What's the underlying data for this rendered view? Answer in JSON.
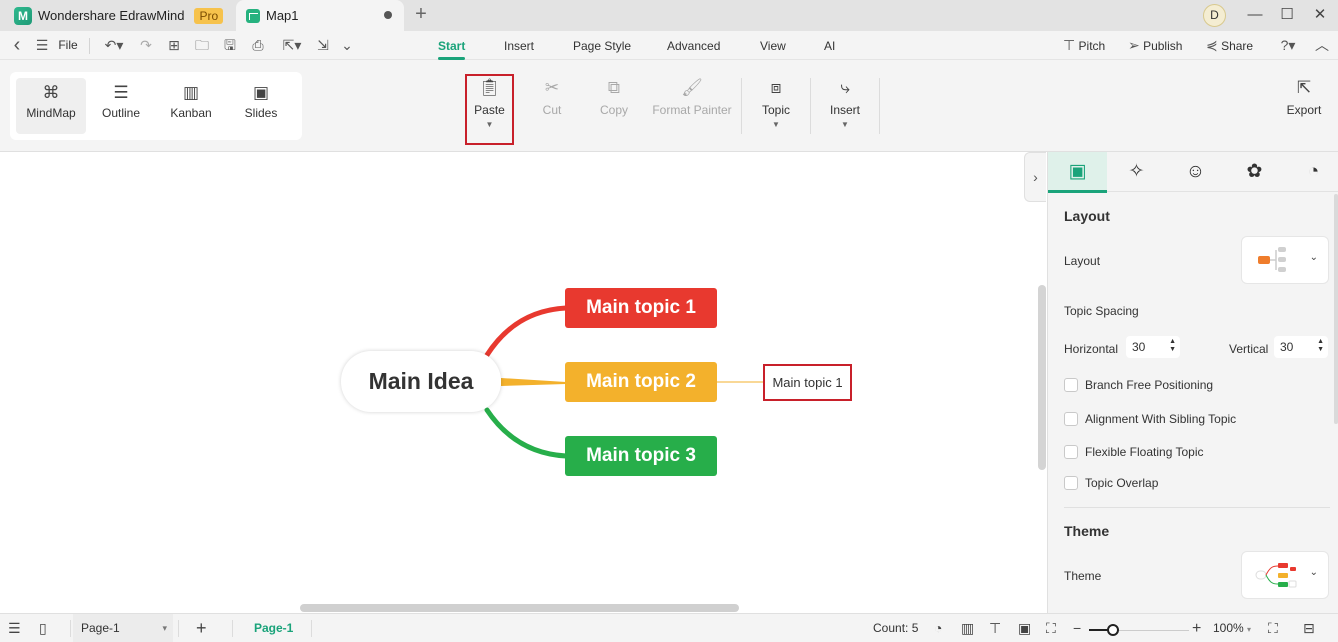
{
  "titlebar": {
    "app_name": "Wondershare EdrawMind",
    "pro_badge": "Pro",
    "document_tab": "Map1",
    "new_tab_symbol": "+",
    "avatar_initial": "D",
    "window_controls": {
      "minimize": "—",
      "maximize": "☐",
      "close": "✕"
    }
  },
  "menubar": {
    "back_symbol": "‹",
    "hamburger_symbol": "☰",
    "file_label": "File",
    "quick_tools": [
      {
        "name": "undo-icon",
        "symbol": "↶▾"
      },
      {
        "name": "redo-icon",
        "symbol": "↷"
      },
      {
        "name": "new-icon",
        "symbol": "⊞"
      },
      {
        "name": "open-folder-icon",
        "symbol": "🗀"
      },
      {
        "name": "save-icon",
        "symbol": "🖫"
      },
      {
        "name": "print-icon",
        "symbol": "⎙"
      },
      {
        "name": "export-file-icon",
        "symbol": "⇱▾"
      },
      {
        "name": "import-icon",
        "symbol": "⇲"
      },
      {
        "name": "more-icon",
        "symbol": "⌄"
      }
    ],
    "tabs": [
      {
        "label": "Start",
        "active": true
      },
      {
        "label": "Insert",
        "active": false
      },
      {
        "label": "Page Style",
        "active": false
      },
      {
        "label": "Advanced",
        "active": false
      },
      {
        "label": "View",
        "active": false
      },
      {
        "label": "AI",
        "active": false
      }
    ],
    "right": {
      "pitch": "Pitch",
      "publish": "Publish",
      "share": "Share",
      "help_symbol": "?▾",
      "collapse_symbol": "︿"
    }
  },
  "ribbon": {
    "views": [
      {
        "label": "MindMap",
        "icon": "⌘",
        "active": true
      },
      {
        "label": "Outline",
        "icon": "☰",
        "active": false
      },
      {
        "label": "Kanban",
        "icon": "▥",
        "active": false
      },
      {
        "label": "Slides",
        "icon": "▣",
        "active": false
      }
    ],
    "paste": {
      "label": "Paste",
      "icon": "📋︎",
      "caret": "▼"
    },
    "cut": {
      "label": "Cut",
      "icon": "✂"
    },
    "copy": {
      "label": "Copy",
      "icon": "⧉"
    },
    "format_painter": {
      "label": "Format Painter",
      "icon": "🖌︎"
    },
    "topic": {
      "label": "Topic",
      "icon": "⧈",
      "caret": "▼"
    },
    "insert": {
      "label": "Insert",
      "icon": "⤷",
      "caret": "▼"
    },
    "export": {
      "label": "Export",
      "icon": "⇱"
    }
  },
  "mindmap": {
    "central": "Main Idea",
    "topics": [
      {
        "label": "Main topic 1",
        "color": "#e8392f"
      },
      {
        "label": "Main topic 2",
        "color": "#f3b12c"
      },
      {
        "label": "Main topic 3",
        "color": "#27ae4a"
      }
    ],
    "subtopic": "Main topic 1",
    "highlight_color": "#c8202a"
  },
  "panel": {
    "tabs": [
      {
        "name": "layout-tab",
        "icon": "▣",
        "active": true
      },
      {
        "name": "ai-style-tab",
        "icon": "✧",
        "active": false
      },
      {
        "name": "icon-tab",
        "icon": "☺",
        "active": false
      },
      {
        "name": "theme-tab",
        "icon": "✿",
        "active": false
      },
      {
        "name": "history-tab",
        "icon": "◔",
        "active": false
      }
    ],
    "layout_section": "Layout",
    "layout_label": "Layout",
    "topic_spacing": "Topic Spacing",
    "horizontal_label": "Horizontal",
    "horizontal_value": "30",
    "vertical_label": "Vertical",
    "vertical_value": "30",
    "checkboxes": [
      {
        "label": "Branch Free Positioning",
        "checked": false
      },
      {
        "label": "Alignment With Sibling Topic",
        "checked": false
      },
      {
        "label": "Flexible Floating Topic",
        "checked": false
      },
      {
        "label": "Topic Overlap",
        "checked": false
      }
    ],
    "theme_section": "Theme",
    "theme_label": "Theme",
    "chevron": "⌄",
    "expand_symbol": "›"
  },
  "statusbar": {
    "page_select": "Page-1",
    "add_page": "+",
    "active_page_tab": "Page-1",
    "count": "Count: 5",
    "zoom_minus": "−",
    "zoom_plus": "+",
    "zoom_level": "100%",
    "zoom_fraction": 0.24,
    "dropdown_caret": "▾"
  },
  "accent_color": "#1aa37a"
}
